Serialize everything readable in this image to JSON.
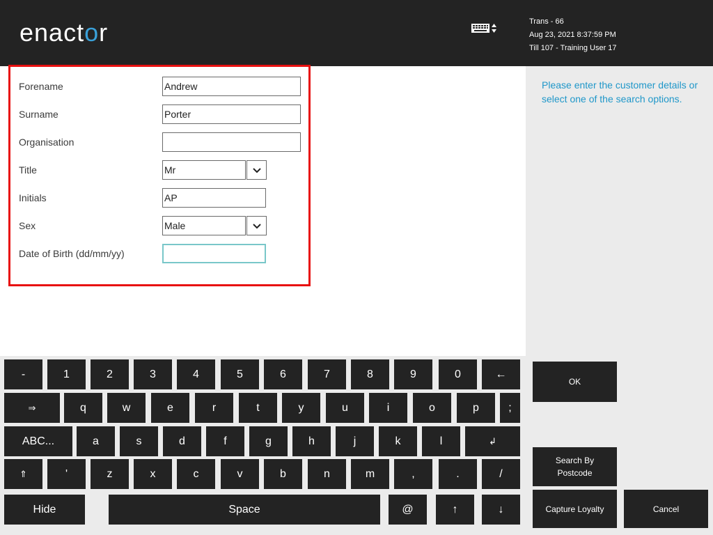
{
  "header": {
    "logo": "enactor",
    "trans": "Trans - 66",
    "datetime": "Aug 23, 2021 8:37:59 PM",
    "till": "Till 107 - Training User 17"
  },
  "form": {
    "forename_label": "Forename",
    "forename_value": "Andrew",
    "surname_label": "Surname",
    "surname_value": "Porter",
    "organisation_label": "Organisation",
    "organisation_value": "",
    "title_label": "Title",
    "title_value": "Mr",
    "initials_label": "Initials",
    "initials_value": "AP",
    "sex_label": "Sex",
    "sex_value": "Male",
    "dob_label": "Date of Birth (dd/mm/yy)",
    "dob_value": ""
  },
  "hint": "Please enter the customer details or select one of the search options.",
  "actions": {
    "ok": "OK",
    "search_postcode_line1": "Search By",
    "search_postcode_line2": "Postcode",
    "capture_loyalty": "Capture Loyalty",
    "cancel": "Cancel"
  },
  "keyboard": {
    "row1": [
      "-",
      "1",
      "2",
      "3",
      "4",
      "5",
      "6",
      "7",
      "8",
      "9",
      "0",
      "←"
    ],
    "row2": [
      "⇒",
      "q",
      "w",
      "e",
      "r",
      "t",
      "y",
      "u",
      "i",
      "o",
      "p",
      ";"
    ],
    "row3": [
      "ABC...",
      "a",
      "s",
      "d",
      "f",
      "g",
      "h",
      "j",
      "k",
      "l",
      "↲"
    ],
    "row4": [
      "⇑",
      "'",
      "z",
      "x",
      "c",
      "v",
      "b",
      "n",
      "m",
      ",",
      ".",
      "/"
    ],
    "row5": [
      "Hide",
      "Space",
      "@",
      "↑",
      "↓"
    ]
  },
  "colors": {
    "header_bg": "#232323",
    "accent_blue": "#1f97c9",
    "form_highlight": "#e81010",
    "focus_border": "#79c7c9"
  }
}
